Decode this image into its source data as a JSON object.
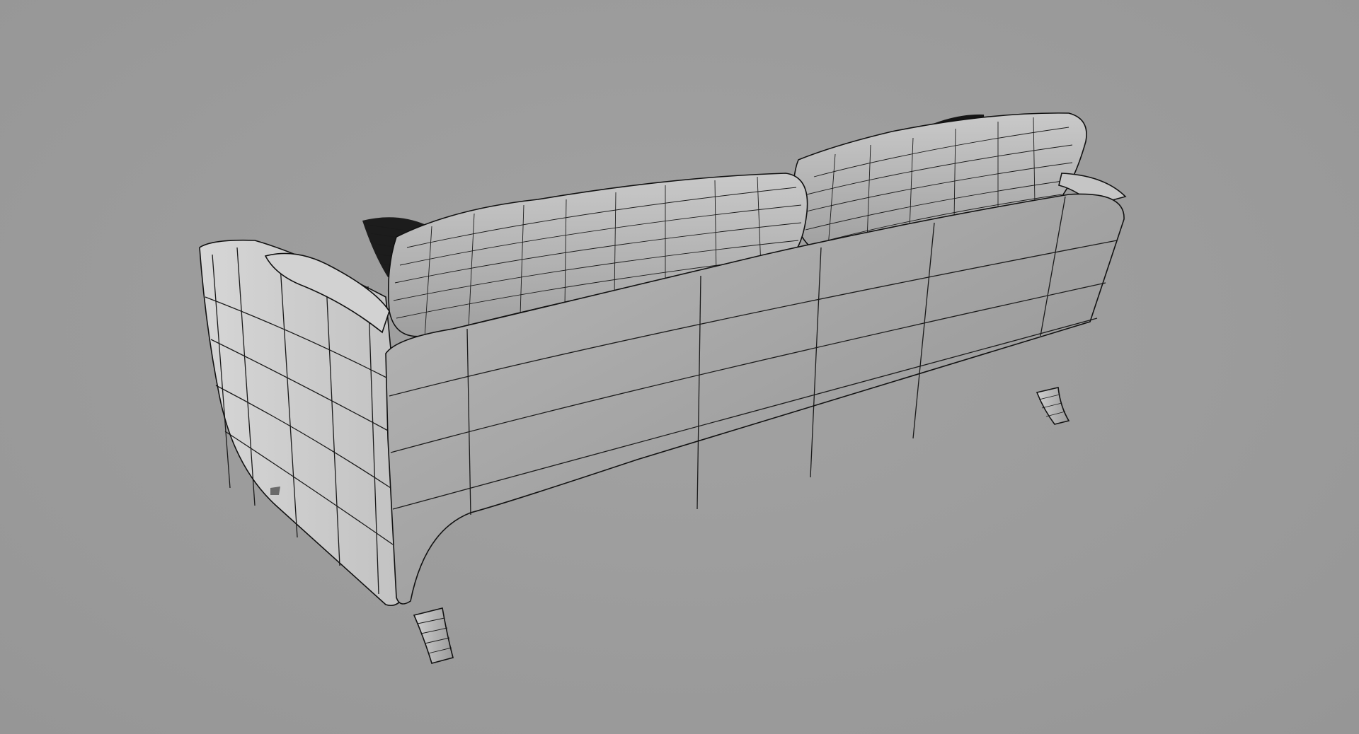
{
  "scene": {
    "background_color": "#9c9c9c",
    "model_fill_light": "#d8d8d8",
    "model_fill_mid": "#bdbdbd",
    "model_fill_dark": "#8f8f8f",
    "wire_color": "#1a1a1a",
    "pillow_color": "#141414"
  }
}
